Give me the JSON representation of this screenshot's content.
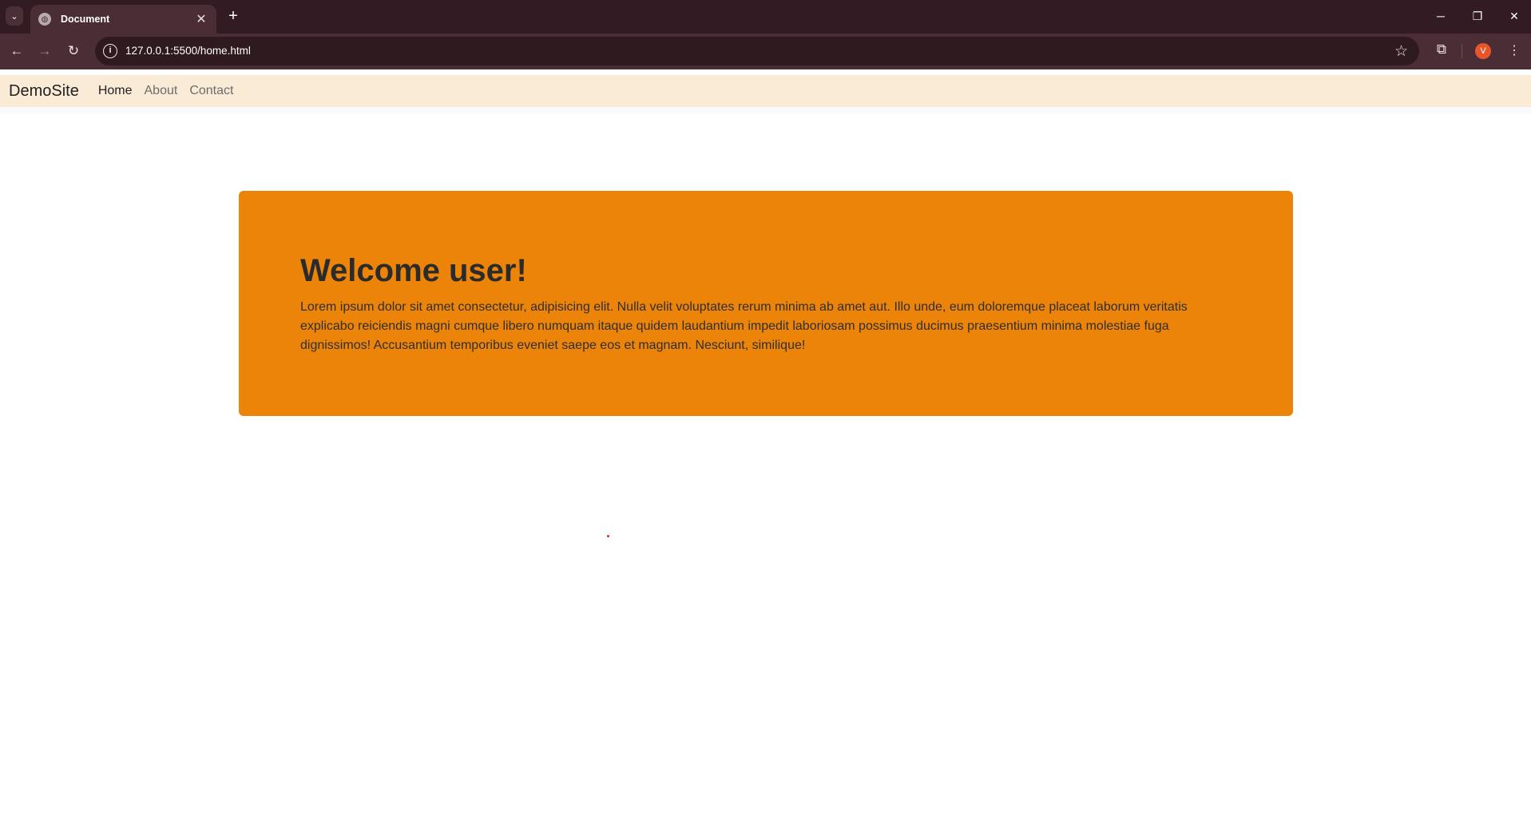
{
  "browser": {
    "tab_title": "Document",
    "tab_close": "✕",
    "new_tab": "+",
    "tab_menu": "⌄",
    "window_controls": {
      "minimize": "─",
      "restore": "❐",
      "close": "✕"
    },
    "url": "127.0.0.1:5500/home.html",
    "nav": {
      "back": "←",
      "forward": "→",
      "reload": "↻"
    },
    "profile_initial": "V",
    "colors": {
      "frame": "#321b22",
      "toolbar": "#4b2d36",
      "omnibox": "#2f1a20",
      "avatar": "#e8552a"
    }
  },
  "navbar": {
    "brand": "DemoSite",
    "links": [
      {
        "label": "Home",
        "active": true
      },
      {
        "label": "About",
        "active": false
      },
      {
        "label": "Contact",
        "active": false
      }
    ],
    "background": "#faebd7"
  },
  "hero": {
    "title": "Welcome user!",
    "text": "Lorem ipsum dolor sit amet consectetur, adipisicing elit. Nulla velit voluptates rerum minima ab amet aut. Illo unde, eum doloremque placeat laborum veritatis explicabo reiciendis magni cumque libero numquam itaque quidem laudantium impedit laboriosam possimus ducimus praesentium minima molestiae fuga dignissimos! Accusantium temporibus eveniet saepe eos et magnam. Nesciunt, similique!",
    "background": "#eb8409"
  }
}
